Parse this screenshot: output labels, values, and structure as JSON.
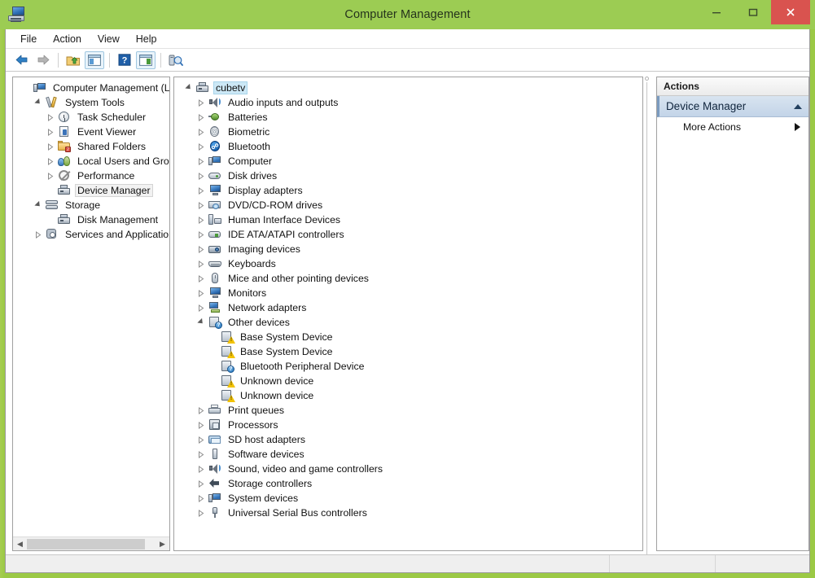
{
  "window": {
    "title": "Computer Management",
    "app_icon": "computer-management-icon",
    "frame_color": "#9bc945",
    "titlebar_color": "#9ccc53",
    "close_button_color": "#d9534f",
    "controls": {
      "minimize": "minimize-button",
      "maximize": "maximize-button",
      "close": "close-button"
    }
  },
  "menu": {
    "items": [
      {
        "label": "File"
      },
      {
        "label": "Action"
      },
      {
        "label": "View"
      },
      {
        "label": "Help"
      }
    ]
  },
  "toolbar": {
    "buttons": [
      {
        "name": "back-button",
        "icon": "back-arrow-icon",
        "framed": false
      },
      {
        "name": "forward-button",
        "icon": "forward-arrow-icon",
        "framed": false
      },
      {
        "name": "up-one-level-button",
        "icon": "folder-up-icon",
        "framed": false
      },
      {
        "name": "show-hide-console-tree-button",
        "icon": "console-tree-icon",
        "framed": true
      },
      {
        "name": "help-button",
        "icon": "help-icon",
        "framed": false
      },
      {
        "name": "show-hide-action-pane-button",
        "icon": "action-pane-icon",
        "framed": true
      },
      {
        "name": "properties-button",
        "icon": "properties-scan-icon",
        "framed": false
      }
    ]
  },
  "console_tree": {
    "items": [
      {
        "label": "Computer Management (Local",
        "indent": 0,
        "twisty": "none",
        "icon": "computer-icon",
        "selected": "none"
      },
      {
        "label": "System Tools",
        "indent": 1,
        "twisty": "open",
        "icon": "tools-icon",
        "selected": "none"
      },
      {
        "label": "Task Scheduler",
        "indent": 2,
        "twisty": "closed",
        "icon": "clock-icon",
        "selected": "none"
      },
      {
        "label": "Event Viewer",
        "indent": 2,
        "twisty": "closed",
        "icon": "event-viewer-icon",
        "selected": "none"
      },
      {
        "label": "Shared Folders",
        "indent": 2,
        "twisty": "closed",
        "icon": "shared-folder-icon",
        "selected": "none"
      },
      {
        "label": "Local Users and Groups",
        "indent": 2,
        "twisty": "closed",
        "icon": "users-icon",
        "selected": "none"
      },
      {
        "label": "Performance",
        "indent": 2,
        "twisty": "closed",
        "icon": "performance-icon",
        "selected": "none"
      },
      {
        "label": "Device Manager",
        "indent": 2,
        "twisty": "none",
        "icon": "device-manager-icon",
        "selected": "inactive"
      },
      {
        "label": "Storage",
        "indent": 1,
        "twisty": "open",
        "icon": "storage-icon",
        "selected": "none"
      },
      {
        "label": "Disk Management",
        "indent": 2,
        "twisty": "none",
        "icon": "disk-management-icon",
        "selected": "none"
      },
      {
        "label": "Services and Applications",
        "indent": 1,
        "twisty": "closed",
        "icon": "services-icon",
        "selected": "none"
      }
    ],
    "hscrollbar": {
      "left_arrow": "scroll-left-arrow",
      "right_arrow": "scroll-right-arrow"
    }
  },
  "device_tree": {
    "items": [
      {
        "label": "cubetv",
        "indent": 0,
        "twisty": "open",
        "icon": "computer-node-icon",
        "selected": "active"
      },
      {
        "label": "Audio inputs and outputs",
        "indent": 1,
        "twisty": "closed",
        "icon": "speaker-icon",
        "selected": "none"
      },
      {
        "label": "Batteries",
        "indent": 1,
        "twisty": "closed",
        "icon": "battery-icon",
        "selected": "none"
      },
      {
        "label": "Biometric",
        "indent": 1,
        "twisty": "closed",
        "icon": "biometric-icon",
        "selected": "none"
      },
      {
        "label": "Bluetooth",
        "indent": 1,
        "twisty": "closed",
        "icon": "bluetooth-icon",
        "selected": "none"
      },
      {
        "label": "Computer",
        "indent": 1,
        "twisty": "closed",
        "icon": "computer-device-icon",
        "selected": "none"
      },
      {
        "label": "Disk drives",
        "indent": 1,
        "twisty": "closed",
        "icon": "disk-drive-icon",
        "selected": "none"
      },
      {
        "label": "Display adapters",
        "indent": 1,
        "twisty": "closed",
        "icon": "display-adapter-icon",
        "selected": "none"
      },
      {
        "label": "DVD/CD-ROM drives",
        "indent": 1,
        "twisty": "closed",
        "icon": "dvd-drive-icon",
        "selected": "none"
      },
      {
        "label": "Human Interface Devices",
        "indent": 1,
        "twisty": "closed",
        "icon": "hid-icon",
        "selected": "none"
      },
      {
        "label": "IDE ATA/ATAPI controllers",
        "indent": 1,
        "twisty": "closed",
        "icon": "ide-controller-icon",
        "selected": "none"
      },
      {
        "label": "Imaging devices",
        "indent": 1,
        "twisty": "closed",
        "icon": "camera-icon",
        "selected": "none"
      },
      {
        "label": "Keyboards",
        "indent": 1,
        "twisty": "closed",
        "icon": "keyboard-icon",
        "selected": "none"
      },
      {
        "label": "Mice and other pointing devices",
        "indent": 1,
        "twisty": "closed",
        "icon": "mouse-icon",
        "selected": "none"
      },
      {
        "label": "Monitors",
        "indent": 1,
        "twisty": "closed",
        "icon": "monitor-icon",
        "selected": "none"
      },
      {
        "label": "Network adapters",
        "indent": 1,
        "twisty": "closed",
        "icon": "network-adapter-icon",
        "selected": "none"
      },
      {
        "label": "Other devices",
        "indent": 1,
        "twisty": "open",
        "icon": "other-devices-icon",
        "selected": "none"
      },
      {
        "label": "Base System Device",
        "indent": 2,
        "twisty": "none",
        "icon": "unknown-device-warning-icon",
        "selected": "none"
      },
      {
        "label": "Base System Device",
        "indent": 2,
        "twisty": "none",
        "icon": "unknown-device-warning-icon",
        "selected": "none"
      },
      {
        "label": "Bluetooth Peripheral Device",
        "indent": 2,
        "twisty": "none",
        "icon": "unknown-device-question-icon",
        "selected": "none"
      },
      {
        "label": "Unknown device",
        "indent": 2,
        "twisty": "none",
        "icon": "unknown-device-warning-icon",
        "selected": "none"
      },
      {
        "label": "Unknown device",
        "indent": 2,
        "twisty": "none",
        "icon": "unknown-device-warning-icon",
        "selected": "none"
      },
      {
        "label": "Print queues",
        "indent": 1,
        "twisty": "closed",
        "icon": "printer-icon",
        "selected": "none"
      },
      {
        "label": "Processors",
        "indent": 1,
        "twisty": "closed",
        "icon": "processor-icon",
        "selected": "none"
      },
      {
        "label": "SD host adapters",
        "indent": 1,
        "twisty": "closed",
        "icon": "sd-card-icon",
        "selected": "none"
      },
      {
        "label": "Software devices",
        "indent": 1,
        "twisty": "closed",
        "icon": "software-device-icon",
        "selected": "none"
      },
      {
        "label": "Sound, video and game controllers",
        "indent": 1,
        "twisty": "closed",
        "icon": "sound-controller-icon",
        "selected": "none"
      },
      {
        "label": "Storage controllers",
        "indent": 1,
        "twisty": "closed",
        "icon": "storage-controller-icon",
        "selected": "none"
      },
      {
        "label": "System devices",
        "indent": 1,
        "twisty": "closed",
        "icon": "system-device-icon",
        "selected": "none"
      },
      {
        "label": "Universal Serial Bus controllers",
        "indent": 1,
        "twisty": "closed",
        "icon": "usb-controller-icon",
        "selected": "none"
      }
    ]
  },
  "actions_pane": {
    "header": "Actions",
    "group_title": "Device Manager",
    "group_collapse_icon": "chevron-up-icon",
    "items": [
      {
        "label": "More Actions",
        "submenu_icon": "triangle-right-icon"
      }
    ]
  },
  "status_bar": {
    "main": "",
    "cell_1": "",
    "cell_2": ""
  }
}
